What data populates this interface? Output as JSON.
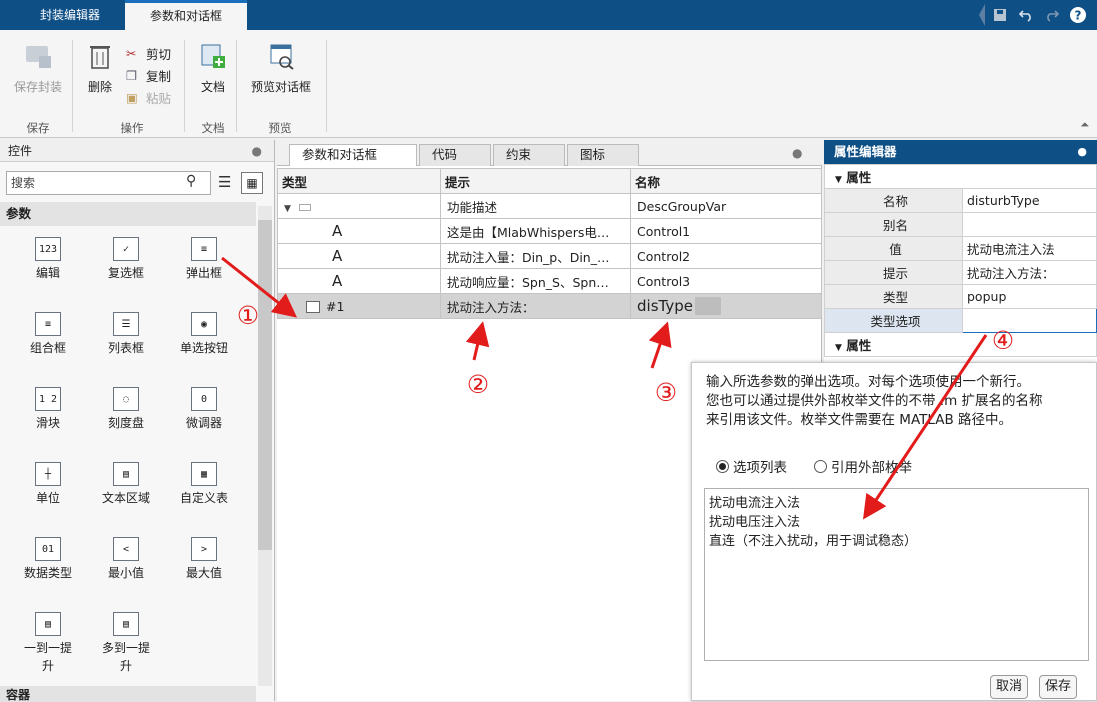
{
  "tabs": {
    "mask_editor": "封装编辑器",
    "params_dialog": "参数和对话框"
  },
  "quick_access": [
    "save-icon",
    "undo-icon",
    "redo-icon",
    "help-icon"
  ],
  "ribbon": {
    "save_mask": "保存封装",
    "delete": "删除",
    "cut": "剪切",
    "copy": "复制",
    "paste": "粘贴",
    "doc": "文档",
    "preview": "预览对话框",
    "group_save": "保存",
    "group_ops": "操作",
    "group_doc": "文档",
    "group_preview": "预览"
  },
  "controls": {
    "title": "控件",
    "search_placeholder": "搜索",
    "section_params": "参数",
    "section_container": "容器",
    "items": [
      {
        "label": "编辑",
        "icon": "123"
      },
      {
        "label": "复选框",
        "icon": "✓"
      },
      {
        "label": "弹出框",
        "icon": "≡"
      },
      {
        "label": "组合框",
        "icon": "≡"
      },
      {
        "label": "列表框",
        "icon": "☰"
      },
      {
        "label": "单选按钮",
        "icon": "◉"
      },
      {
        "label": "滑块",
        "icon": "1 2"
      },
      {
        "label": "刻度盘",
        "icon": "◌"
      },
      {
        "label": "微调器",
        "icon": "0"
      },
      {
        "label": "单位",
        "icon": "┼"
      },
      {
        "label": "文本区域",
        "icon": "▤"
      },
      {
        "label": "自定义表",
        "icon": "▦"
      },
      {
        "label": "数据类型",
        "icon": "01"
      },
      {
        "label": "最小值",
        "icon": "<"
      },
      {
        "label": "最大值",
        "icon": ">"
      },
      {
        "label": "一到一提升",
        "icon": "▤"
      },
      {
        "label": "多到一提升",
        "icon": "▤"
      }
    ]
  },
  "center": {
    "tabs": [
      "参数和对话框",
      "代码",
      "约束",
      "图标"
    ],
    "headers": [
      "类型",
      "提示",
      "名称"
    ],
    "rows": [
      {
        "type": "",
        "prompt": "功能描述",
        "name": "DescGroupVar"
      },
      {
        "type": "A",
        "prompt": "这是由【MlabWhispers电…",
        "name": "Control1"
      },
      {
        "type": "A",
        "prompt": "扰动注入量：Din_p、Din_…",
        "name": "Control2"
      },
      {
        "type": "A",
        "prompt": "扰动响应量：Spn_S、Spn…",
        "name": "Control3"
      },
      {
        "type": "#1",
        "prompt": "扰动注入方法：",
        "name": "disType"
      }
    ]
  },
  "props": {
    "title": "属性编辑器",
    "section": "属性",
    "section2": "属性",
    "rows": [
      {
        "key": "名称",
        "value": "disturbType"
      },
      {
        "key": "别名",
        "value": ""
      },
      {
        "key": "值",
        "value": "扰动电流注入法"
      },
      {
        "key": "提示",
        "value": "扰动注入方法："
      },
      {
        "key": "类型",
        "value": "popup"
      },
      {
        "key": "类型选项",
        "value": ""
      }
    ]
  },
  "popup": {
    "line1": "输入所选参数的弹出选项。对每个选项使用一个新行。",
    "line2": "您也可以通过提供外部枚举文件的不带 .m 扩展名的名称",
    "line3": "来引用该文件。枚举文件需要在 MATLAB 路径中。",
    "radio_list": "选项列表",
    "radio_enum": "引用外部枚举",
    "options": [
      "扰动电流注入法",
      "扰动电压注入法",
      "直连（不注入扰动，用于调试稳态）"
    ],
    "cancel": "取消",
    "save": "保存"
  },
  "annotations": [
    "①",
    "②",
    "③",
    "④"
  ],
  "colors": {
    "titlebar": "#0e4f86",
    "accent": "#1a6fbd",
    "annotation": "#e21b1b",
    "selected_row": "#d3d3d3"
  }
}
